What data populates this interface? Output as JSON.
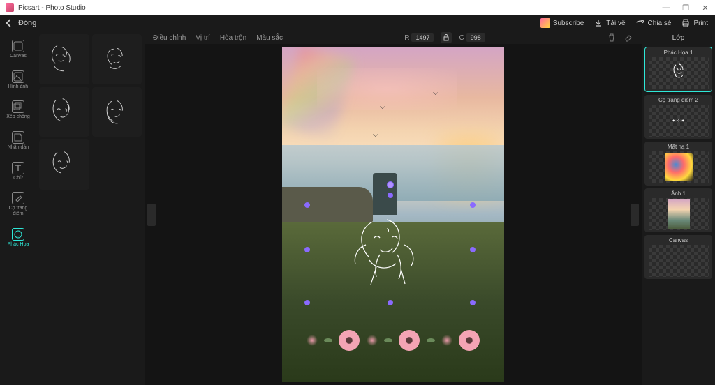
{
  "window": {
    "title": "Picsart - Photo Studio"
  },
  "topbar": {
    "back": "Đóng",
    "subscribe": "Subscribe",
    "download": "Tải về",
    "share": "Chia sẻ",
    "print": "Print"
  },
  "left_rail": [
    {
      "id": "canvas",
      "label": "Canvas"
    },
    {
      "id": "image",
      "label": "Hình ảnh"
    },
    {
      "id": "stack",
      "label": "Xếp chồng"
    },
    {
      "id": "sticker",
      "label": "Nhãn dán"
    },
    {
      "id": "text",
      "label": "Chữ"
    },
    {
      "id": "makeup",
      "label": "Cọ trang điểm"
    },
    {
      "id": "sketch",
      "label": "Phác Họa",
      "active": true
    }
  ],
  "canvas_toolbar": {
    "tabs": [
      "Điều chỉnh",
      "Vị trí",
      "Hòa trộn",
      "Màu sắc"
    ],
    "coords": {
      "r_label": "R",
      "r": "1497",
      "c_label": "C",
      "c": "998"
    }
  },
  "right_panel": {
    "header": "Lớp",
    "layers": [
      {
        "name": "Phác Họa 1",
        "type": "sketch",
        "active": true
      },
      {
        "name": "Cọ trang điểm 2",
        "type": "brush"
      },
      {
        "name": "Mặt nạ 1",
        "type": "mask"
      },
      {
        "name": "Ảnh 1",
        "type": "photo"
      },
      {
        "name": "Canvas",
        "type": "canvas"
      }
    ]
  }
}
